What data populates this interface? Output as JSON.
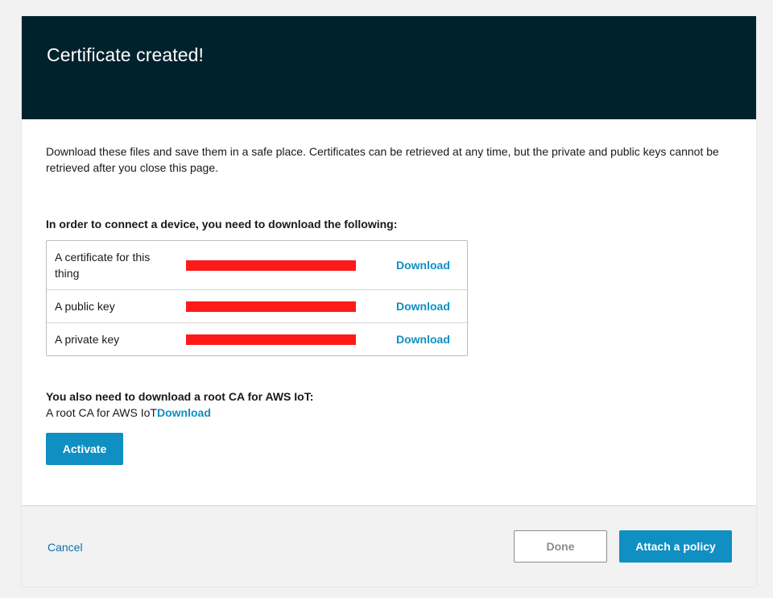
{
  "header": {
    "title": "Certificate created!"
  },
  "intro": {
    "text": "Download these files and save them in a safe place. Certificates can be retrieved at any time, but the private and public keys cannot be retrieved after you close this page."
  },
  "files_section": {
    "title": "In order to connect a device, you need to download the following:",
    "rows": [
      {
        "label": "A certificate for this thing",
        "download_label": "Download"
      },
      {
        "label": "A public key",
        "download_label": "Download"
      },
      {
        "label": "A private key",
        "download_label": "Download"
      }
    ]
  },
  "root_ca": {
    "title": "You also need to download a root CA for AWS IoT:",
    "label": "A root CA for AWS IoT",
    "download_label": "Download"
  },
  "activate_button": {
    "label": "Activate"
  },
  "footer": {
    "cancel_label": "Cancel",
    "done_label": "Done",
    "attach_label": "Attach a policy"
  },
  "colors": {
    "header_bg": "#00222d",
    "accent": "#0f8fc2",
    "redaction": "#ff1a1a"
  }
}
